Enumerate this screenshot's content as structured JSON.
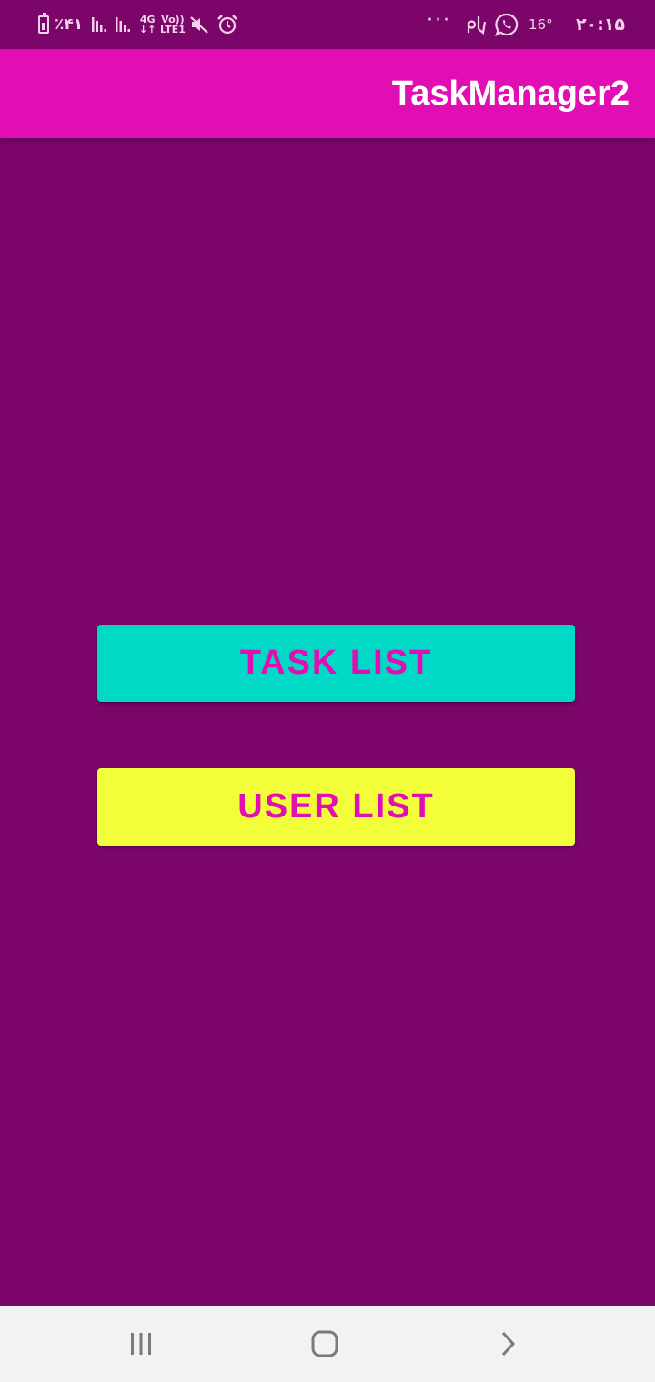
{
  "status_bar": {
    "battery_text": "٪۴۱",
    "network_type": "4G",
    "volte_line1": "Vo))",
    "volte_line2": "LTE1",
    "more_dots": "···",
    "temperature": "16°",
    "time": "۲۰:۱۵",
    "icons": [
      "battery-icon",
      "signal-icon",
      "signal-icon",
      "network-4g-icon",
      "volte-icon",
      "mute-icon",
      "alarm-icon",
      "more-icon",
      "pi-icon",
      "whatsapp-icon",
      "weather-icon"
    ]
  },
  "app_bar": {
    "title": "TaskManager2",
    "color": "#e10eb3"
  },
  "main": {
    "background": "#7b0569",
    "buttons": [
      {
        "label": "TASK LIST",
        "background": "#00d9c6",
        "text_color": "#e10eb3"
      },
      {
        "label": "USER LIST",
        "background": "#f2fe3a",
        "text_color": "#e10eb3"
      }
    ]
  },
  "nav_bar": {
    "items": [
      "recent-apps-icon",
      "home-icon",
      "back-icon"
    ]
  }
}
